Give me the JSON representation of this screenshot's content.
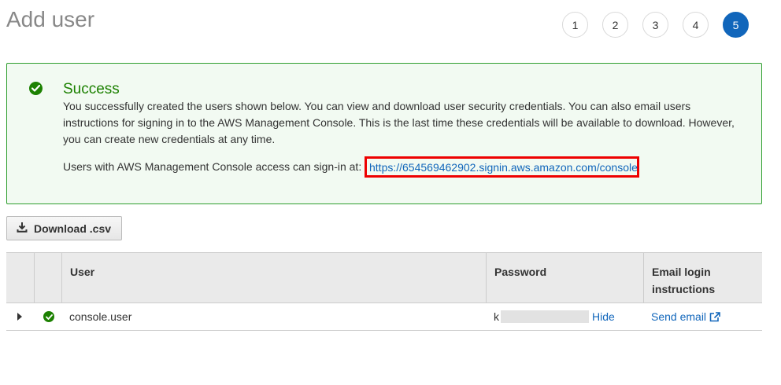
{
  "page": {
    "title": "Add user"
  },
  "steps": [
    "1",
    "2",
    "3",
    "4",
    "5"
  ],
  "active_step": "5",
  "alert": {
    "title": "Success",
    "body": "You successfully created the users shown below. You can view and download user security credentials. You can also email users instructions for signing in to the AWS Management Console. This is the last time these credentials will be available to download. However, you can create new credentials at any time.",
    "signin_label": "Users with AWS Management Console access can sign-in at:",
    "signin_url": "https://654569462902.signin.aws.amazon.com/console"
  },
  "download_button": {
    "label": "Download .csv"
  },
  "table": {
    "headers": {
      "user": "User",
      "password": "Password",
      "email": "Email login instructions"
    },
    "rows": [
      {
        "user": "console.user",
        "password_visible_char": "k",
        "hide_label": "Hide",
        "email_label": "Send email"
      }
    ]
  },
  "colors": {
    "accent": "#1166bb",
    "success": "#1d8102",
    "highlight_box": "#ee0000"
  },
  "icons": {
    "success": "check-circle-icon",
    "download": "download-icon",
    "expand": "caret-right-icon",
    "external": "external-link-icon"
  }
}
